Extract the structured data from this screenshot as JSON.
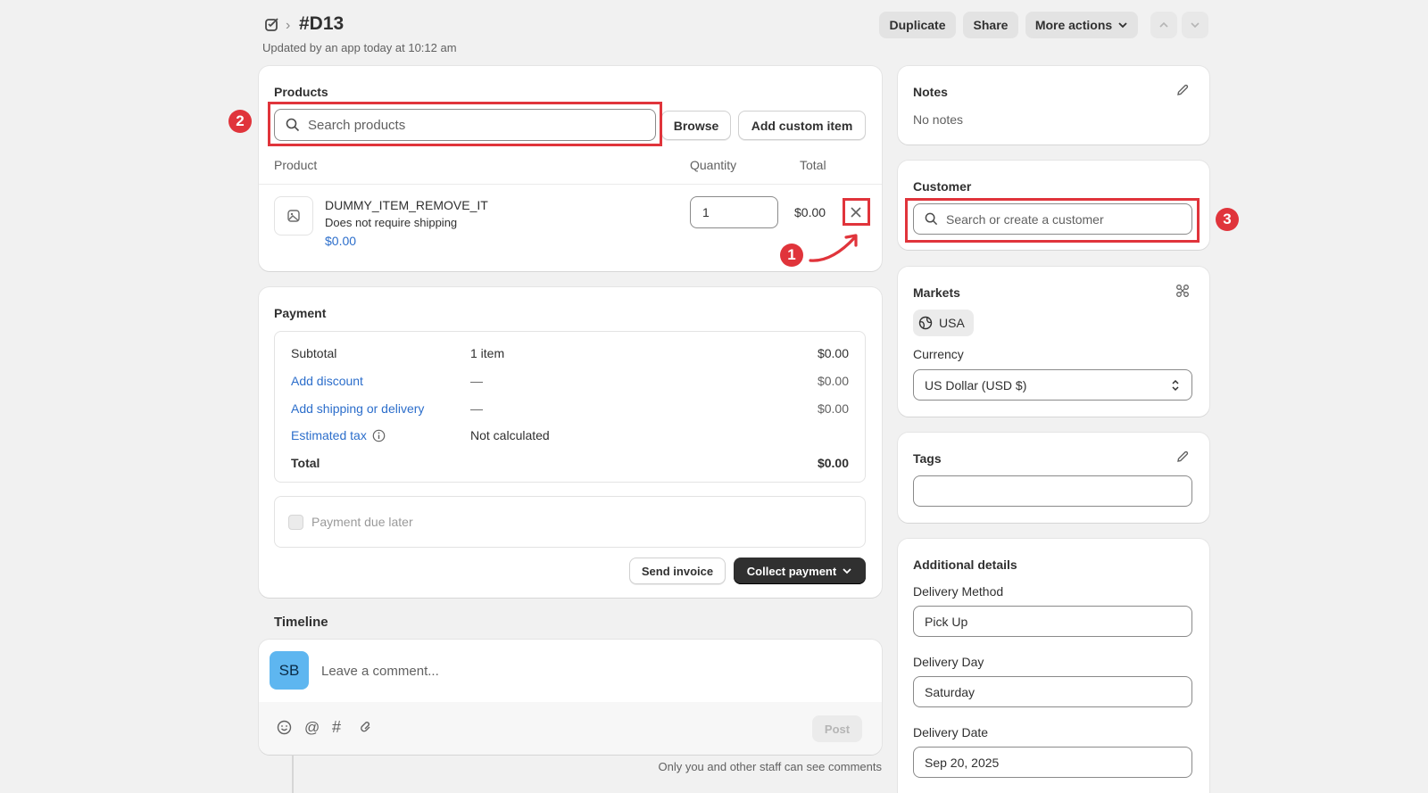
{
  "header": {
    "title": "#D13",
    "subtitle": "Updated by an app today at 10:12 am",
    "duplicate_label": "Duplicate",
    "share_label": "Share",
    "more_actions_label": "More actions"
  },
  "products": {
    "heading": "Products",
    "search_placeholder": "Search products",
    "browse_label": "Browse",
    "add_custom_label": "Add custom item",
    "columns": [
      "Product",
      "Quantity",
      "Total"
    ],
    "item": {
      "name": "DUMMY_ITEM_REMOVE_IT",
      "shipping": "Does not require shipping",
      "price": "$0.00",
      "quantity": "1",
      "total": "$0.00"
    }
  },
  "payment": {
    "heading": "Payment",
    "rows": [
      {
        "label": "Subtotal",
        "middle": "1 item",
        "amount": "$0.00"
      },
      {
        "label": "Add discount",
        "middle": "—",
        "amount": "$0.00"
      },
      {
        "label": "Add shipping or delivery",
        "middle": "—",
        "amount": "$0.00"
      },
      {
        "label": "Estimated tax",
        "middle": "Not calculated",
        "amount": ""
      },
      {
        "label": "Total",
        "middle": "",
        "amount": "$0.00"
      }
    ],
    "due_later_label": "Payment due later",
    "send_invoice_label": "Send invoice",
    "collect_payment_label": "Collect payment"
  },
  "timeline": {
    "heading": "Timeline",
    "avatar_initials": "SB",
    "comment_placeholder": "Leave a comment...",
    "post_label": "Post",
    "footnote": "Only you and other staff can see comments"
  },
  "notes": {
    "heading": "Notes",
    "text": "No notes"
  },
  "customer": {
    "heading": "Customer",
    "search_placeholder": "Search or create a customer"
  },
  "markets": {
    "heading": "Markets",
    "market": "USA",
    "currency_label": "Currency",
    "currency_value": "US Dollar (USD $)"
  },
  "tags": {
    "heading": "Tags",
    "value": ""
  },
  "additional": {
    "heading": "Additional details",
    "fields": [
      {
        "label": "Delivery Method",
        "value": "Pick Up"
      },
      {
        "label": "Delivery Day",
        "value": "Saturday"
      },
      {
        "label": "Delivery Date",
        "value": "Sep 20, 2025"
      }
    ]
  },
  "annotations": [
    "1",
    "2",
    "3"
  ],
  "colors": {
    "annotation_red": "#e0343b",
    "link_blue": "#2c6ecb",
    "avatar_blue": "#5eb6f0",
    "primary_button": "#303030",
    "page_bg": "#f1f1f1"
  }
}
